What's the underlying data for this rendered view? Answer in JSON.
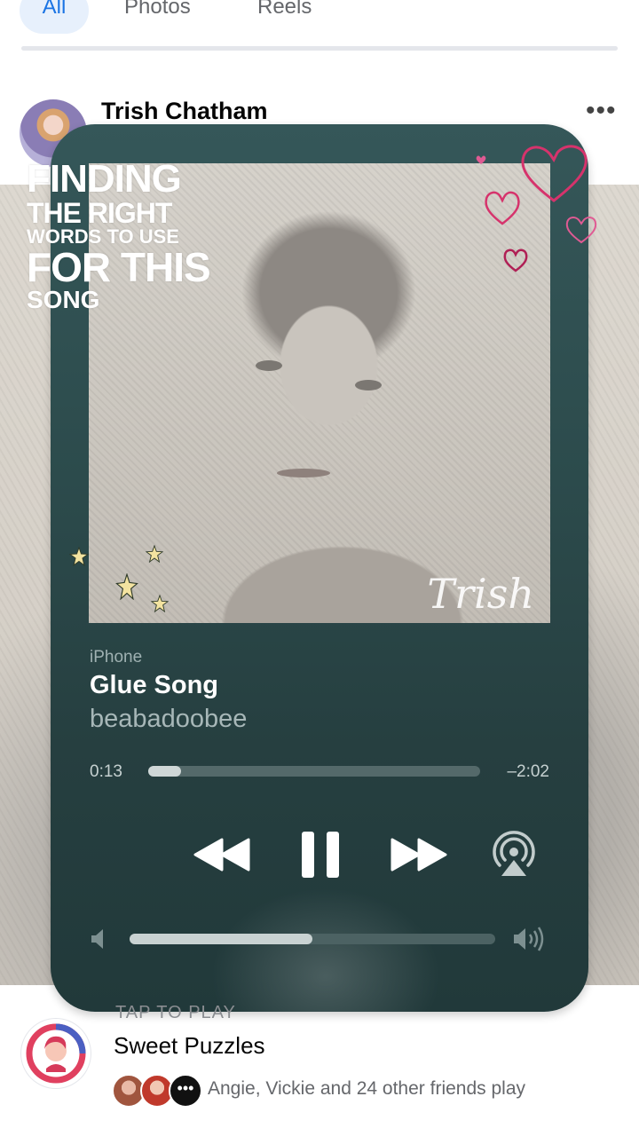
{
  "tabs": {
    "all": "All",
    "photos": "Photos",
    "reels": "Reels"
  },
  "post": {
    "author": "Trish Chatham",
    "more": "•••",
    "overlay_text": [
      "FINDING",
      "THE RIGHT",
      "WORDS TO USE",
      "FOR THIS",
      "SONG"
    ]
  },
  "player": {
    "device": "iPhone",
    "title": "Glue Song",
    "artist": "beabadoobee",
    "elapsed": "0:13",
    "remaining": "–2:02",
    "progress": 0.1,
    "volume": 0.5,
    "artwork_signature": "Trish"
  },
  "ad": {
    "tap_label": "TAP TO PLAY",
    "title": "Sweet Puzzles",
    "friends_text": "Angie, Vickie and 24 other friends play",
    "more_friends": "•••"
  },
  "colors": {
    "player_bg": "#2c4b4c",
    "accent_blue": "#1b74e4",
    "hearts": "#d6336c",
    "stars": "#f3e3a0"
  },
  "icons": [
    "rewind-icon",
    "pause-icon",
    "fast-forward-icon",
    "airplay-icon",
    "volume-low-icon",
    "volume-high-icon",
    "more-icon",
    "heart-icon",
    "star-icon"
  ]
}
